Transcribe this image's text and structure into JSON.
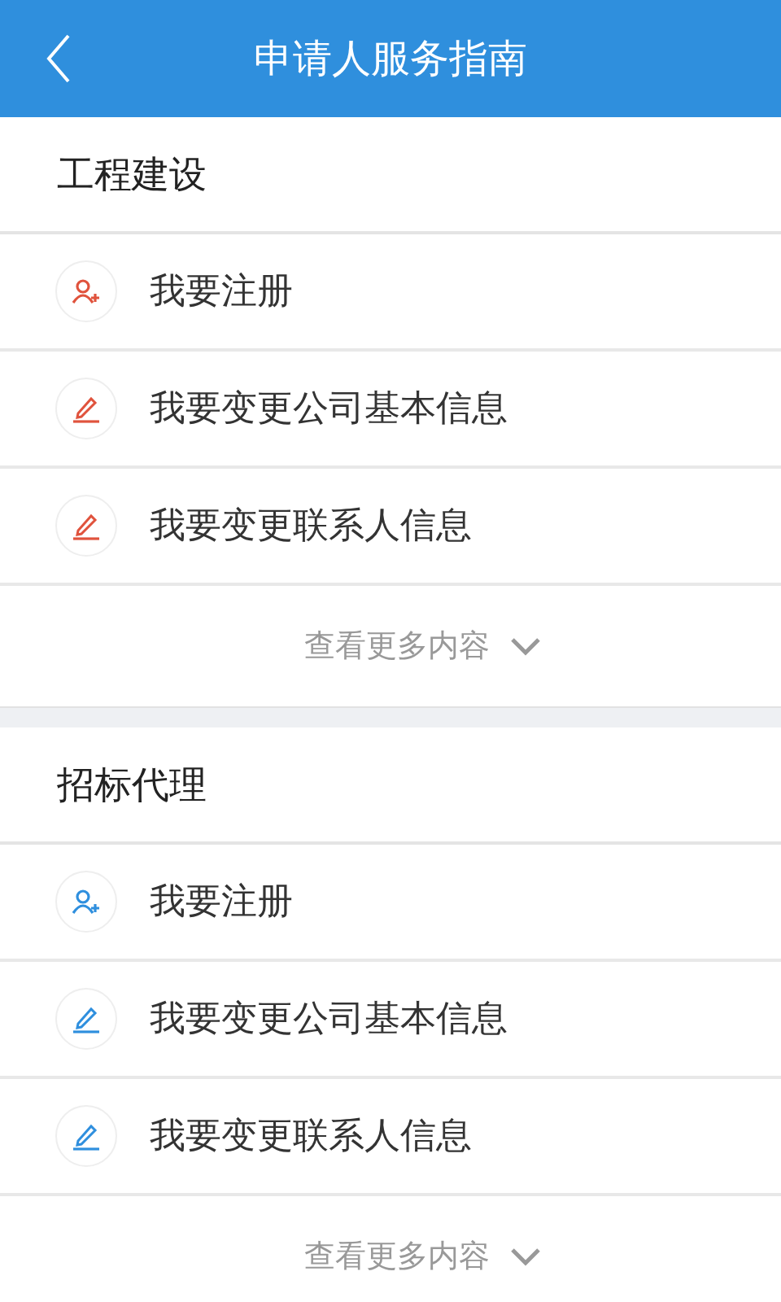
{
  "header": {
    "title": "申请人服务指南"
  },
  "sections": [
    {
      "title": "工程建设",
      "color": "#e0533d",
      "items": [
        {
          "kind": "register",
          "label": "我要注册"
        },
        {
          "kind": "edit",
          "label": "我要变更公司基本信息"
        },
        {
          "kind": "edit",
          "label": "我要变更联系人信息"
        }
      ],
      "more": "查看更多内容"
    },
    {
      "title": "招标代理",
      "color": "#2f8fde",
      "items": [
        {
          "kind": "register",
          "label": "我要注册"
        },
        {
          "kind": "edit",
          "label": "我要变更公司基本信息"
        },
        {
          "kind": "edit",
          "label": "我要变更联系人信息"
        }
      ],
      "more": "查看更多内容"
    }
  ]
}
